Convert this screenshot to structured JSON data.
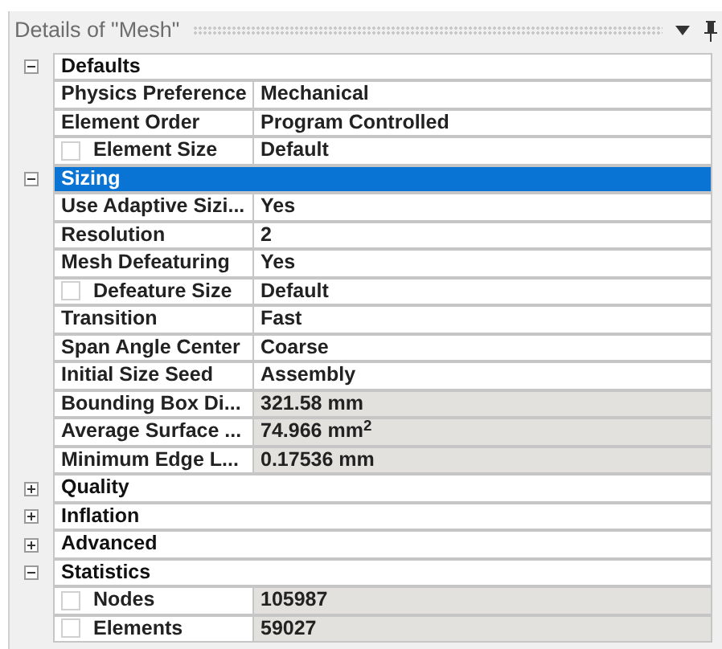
{
  "panel": {
    "title": "Details of \"Mesh\""
  },
  "sections": [
    {
      "name": "Defaults",
      "expanded": true,
      "selected": false,
      "properties": [
        {
          "label": "Physics Preference",
          "value": "Mechanical",
          "kind": "plain",
          "readonly": false
        },
        {
          "label": "Element Order",
          "value": "Program Controlled",
          "kind": "plain",
          "readonly": false
        },
        {
          "label": "Element Size",
          "value": "Default",
          "kind": "checkbox",
          "checked": false,
          "readonly": false
        }
      ]
    },
    {
      "name": "Sizing",
      "expanded": true,
      "selected": true,
      "properties": [
        {
          "label": "Use Adaptive Sizi...",
          "value": "Yes",
          "kind": "plain",
          "readonly": false
        },
        {
          "label": "Resolution",
          "value": "2",
          "kind": "plain",
          "readonly": false
        },
        {
          "label": "Mesh Defeaturing",
          "value": "Yes",
          "kind": "plain",
          "readonly": false
        },
        {
          "label": "Defeature Size",
          "value": "Default",
          "kind": "checkbox",
          "checked": false,
          "readonly": false
        },
        {
          "label": "Transition",
          "value": "Fast",
          "kind": "plain",
          "readonly": false
        },
        {
          "label": "Span Angle Center",
          "value": "Coarse",
          "kind": "plain",
          "readonly": false
        },
        {
          "label": "Initial Size Seed",
          "value": "Assembly",
          "kind": "plain",
          "readonly": false
        },
        {
          "label": "Bounding Box Di...",
          "value": "321.58 mm",
          "kind": "plain",
          "readonly": true
        },
        {
          "label": "Average Surface ...",
          "value": "74.966 mm$^{2}$",
          "kind": "plain",
          "readonly": true
        },
        {
          "label": "Minimum Edge L...",
          "value": "0.17536 mm",
          "kind": "plain",
          "readonly": true
        }
      ]
    },
    {
      "name": "Quality",
      "expanded": false,
      "selected": false
    },
    {
      "name": "Inflation",
      "expanded": false,
      "selected": false
    },
    {
      "name": "Advanced",
      "expanded": false,
      "selected": false
    },
    {
      "name": "Statistics",
      "expanded": true,
      "selected": false,
      "properties": [
        {
          "label": "Nodes",
          "value": "105987",
          "kind": "checkbox",
          "checked": false,
          "readonly": true
        },
        {
          "label": "Elements",
          "value": "59027",
          "kind": "checkbox",
          "checked": false,
          "readonly": true
        }
      ]
    }
  ]
}
